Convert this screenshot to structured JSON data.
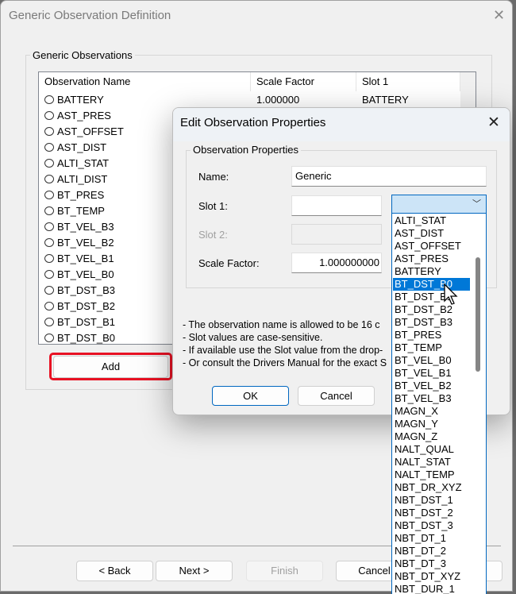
{
  "main_window": {
    "title": "Generic Observation Definition",
    "group_label": "Generic Observations",
    "columns": [
      "Observation Name",
      "Scale Factor",
      "Slot 1"
    ],
    "rows": [
      {
        "name": "BATTERY",
        "scale": "1.000000",
        "slot1": "BATTERY"
      },
      {
        "name": "AST_PRES"
      },
      {
        "name": "AST_OFFSET"
      },
      {
        "name": "AST_DIST"
      },
      {
        "name": "ALTI_STAT"
      },
      {
        "name": "ALTI_DIST"
      },
      {
        "name": "BT_PRES"
      },
      {
        "name": "BT_TEMP"
      },
      {
        "name": "BT_VEL_B3"
      },
      {
        "name": "BT_VEL_B2"
      },
      {
        "name": "BT_VEL_B1"
      },
      {
        "name": "BT_VEL_B0"
      },
      {
        "name": "BT_DST_B3"
      },
      {
        "name": "BT_DST_B2"
      },
      {
        "name": "BT_DST_B1"
      },
      {
        "name": "BT_DST_B0"
      }
    ],
    "add_label": "Add",
    "back_label": "< Back",
    "next_label": "Next >",
    "finish_label": "Finish",
    "cancel_label": "Cancel",
    "highlight_color": "#e81123"
  },
  "dialog": {
    "title": "Edit Observation Properties",
    "group_label": "Observation Properties",
    "name_label": "Name:",
    "name_value": "Generic",
    "slot1_label": "Slot 1:",
    "slot1_value": "",
    "slot2_label": "Slot 2:",
    "scale_label": "Scale Factor:",
    "scale_value": "1.000000000",
    "notes": [
      "- The observation name is allowed to be 16 c",
      "- Slot values are case-sensitive.",
      "- If available use the Slot value from the drop-",
      "- Or consult the Drivers Manual for the exact S"
    ],
    "ok_label": "OK",
    "cancel_label": "Cancel",
    "dropdown": {
      "selected": "BT_DST_B0",
      "options": [
        "ALTI_STAT",
        "AST_DIST",
        "AST_OFFSET",
        "AST_PRES",
        "BATTERY",
        "BT_DST_B0",
        "BT_DST_B1",
        "BT_DST_B2",
        "BT_DST_B3",
        "BT_PRES",
        "BT_TEMP",
        "BT_VEL_B0",
        "BT_VEL_B1",
        "BT_VEL_B2",
        "BT_VEL_B3",
        "MAGN_X",
        "MAGN_Y",
        "MAGN_Z",
        "NALT_QUAL",
        "NALT_STAT",
        "NALT_TEMP",
        "NBT_DR_XYZ",
        "NBT_DST_1",
        "NBT_DST_2",
        "NBT_DST_3",
        "NBT_DT_1",
        "NBT_DT_2",
        "NBT_DT_3",
        "NBT_DT_XYZ",
        "NBT_DUR_1"
      ]
    }
  }
}
